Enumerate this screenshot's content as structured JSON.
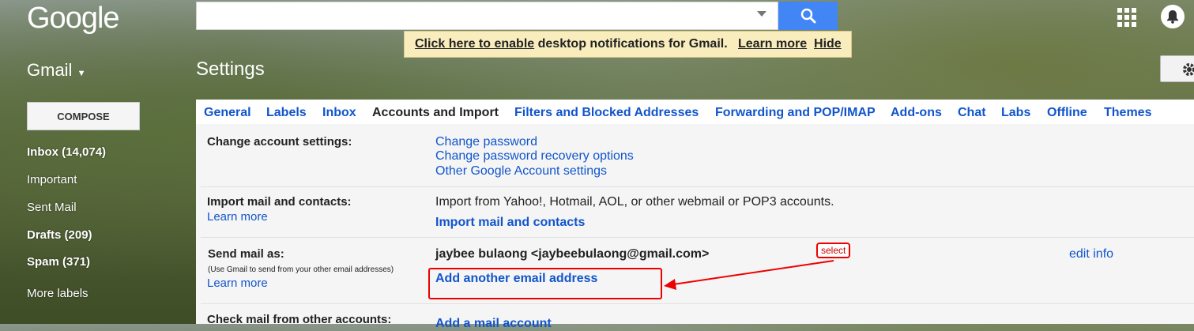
{
  "header": {
    "logo": "Google",
    "app_label": "Gmail",
    "page_title": "Settings",
    "search_placeholder": ""
  },
  "notification_bar": {
    "enable_link": "Click here to enable",
    "message": "desktop notifications for Gmail.",
    "learn_more": "Learn more",
    "hide": "Hide"
  },
  "sidebar": {
    "compose": "COMPOSE",
    "items": [
      {
        "label": "Inbox (14,074)"
      },
      {
        "label": "Important"
      },
      {
        "label": "Sent Mail"
      },
      {
        "label": "Drafts (209)"
      },
      {
        "label": "Spam (371)"
      },
      {
        "label": "More labels"
      }
    ]
  },
  "tabs": [
    {
      "label": "General"
    },
    {
      "label": "Labels"
    },
    {
      "label": "Inbox"
    },
    {
      "label": "Accounts and Import",
      "active": true
    },
    {
      "label": "Filters and Blocked Addresses"
    },
    {
      "label": "Forwarding and POP/IMAP"
    },
    {
      "label": "Add-ons"
    },
    {
      "label": "Chat"
    },
    {
      "label": "Labs"
    },
    {
      "label": "Offline"
    },
    {
      "label": "Themes"
    }
  ],
  "sections": {
    "change_account": {
      "label": "Change account settings:",
      "links": [
        "Change password",
        "Change password recovery options",
        "Other Google Account settings"
      ]
    },
    "import": {
      "label": "Import mail and contacts:",
      "learn_more": "Learn more",
      "description": "Import from Yahoo!, Hotmail, AOL, or other webmail or POP3 accounts.",
      "action": "Import mail and contacts"
    },
    "send_as": {
      "label": "Send mail as:",
      "note": "(Use Gmail to send from your other email addresses)",
      "learn_more": "Learn more",
      "address": "jaybee bulaong <jaybeebulaong@gmail.com>",
      "edit": "edit info",
      "add": "Add another email address"
    },
    "check_mail": {
      "label": "Check mail from other accounts:",
      "action": "Add a mail account"
    }
  },
  "annotation": {
    "tag": "select",
    "color": "#e00000"
  },
  "colors": {
    "link": "#1155cc",
    "search_button": "#4285f4",
    "notify_bg": "#f9edbe"
  }
}
